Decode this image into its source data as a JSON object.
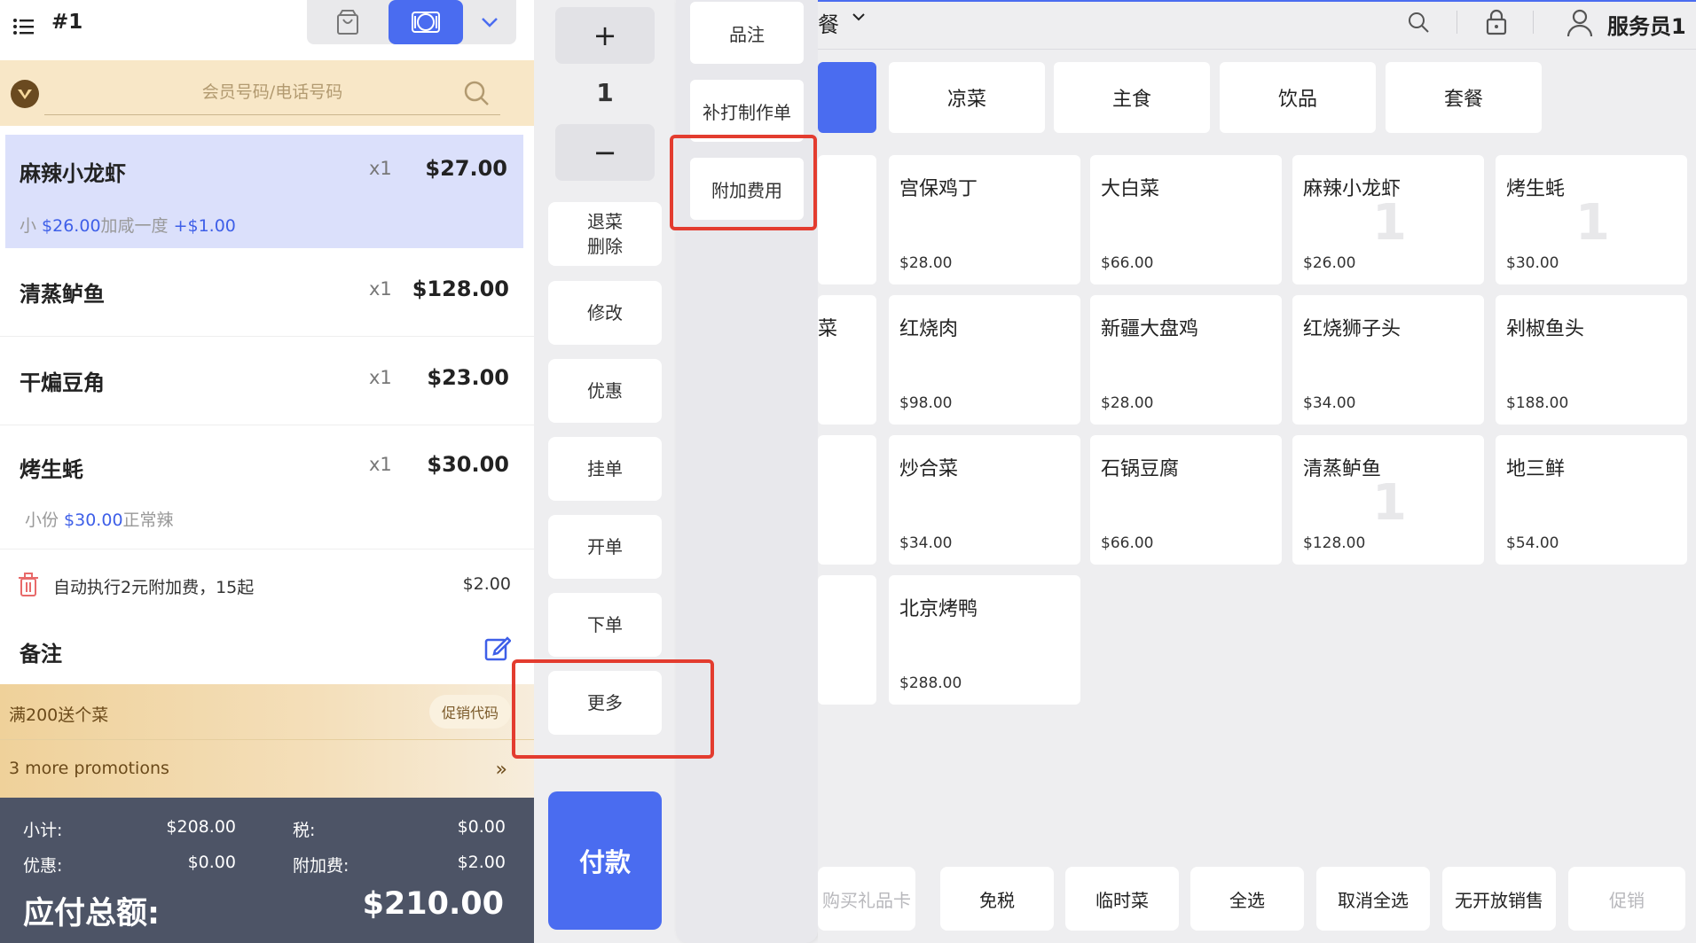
{
  "header": {
    "order_number": "#1"
  },
  "member": {
    "placeholder": "会员号码/电话号码"
  },
  "order_items": [
    {
      "name": "麻辣小龙虾",
      "qty": "x1",
      "price": "$27.00",
      "mod_prefix": "小 ",
      "mod_price": "$26.00",
      "mod_text": "加咸一度 ",
      "mod_extra": "+$1.00"
    },
    {
      "name": "清蒸鲈鱼",
      "qty": "x1",
      "price": "$128.00"
    },
    {
      "name": "干煸豆角",
      "qty": "x1",
      "price": "$23.00"
    },
    {
      "name": "烤生蚝",
      "qty": "x1",
      "price": "$30.00",
      "mod_prefix": "小份 ",
      "mod_price": "$30.00",
      "mod_text": "正常辣"
    }
  ],
  "surcharge": {
    "label": "自动执行2元附加费，15起",
    "amount": "$2.00"
  },
  "note": {
    "label": "备注"
  },
  "promotions": {
    "line1": "满200送个菜",
    "code_button": "促销代码",
    "more": "3 more promotions",
    "arrow": "»"
  },
  "summary": {
    "subtotal_label": "小计:",
    "subtotal": "$208.00",
    "tax_label": "税:",
    "tax": "$0.00",
    "discount_label": "优惠:",
    "discount": "$0.00",
    "fee_label": "附加费:",
    "fee": "$2.00",
    "total_label": "应付总额:",
    "total": "$210.00"
  },
  "actions": {
    "plus": "+",
    "qty": "1",
    "minus": "−",
    "void_line1": "退菜",
    "void_line2": "删除",
    "modify": "修改",
    "discount": "优惠",
    "hold": "挂单",
    "open": "开单",
    "place": "下单",
    "more": "更多",
    "pay": "付款"
  },
  "more_menu": {
    "note": "品注",
    "reprint": "补打制作单",
    "extra_fee": "附加费用"
  },
  "top_right": {
    "category_partial": "餐",
    "user": "服务员1"
  },
  "categories": [
    "凉菜",
    "主食",
    "饮品",
    "套餐"
  ],
  "dishes": [
    {
      "name": "宫保鸡丁",
      "price": "$28.00",
      "qty": ""
    },
    {
      "name": "大白菜",
      "price": "$66.00",
      "qty": ""
    },
    {
      "name": "麻辣小龙虾",
      "price": "$26.00",
      "qty": "1"
    },
    {
      "name": "烤生蚝",
      "price": "$30.00",
      "qty": "1"
    },
    {
      "name": "红烧肉",
      "price": "$98.00",
      "qty": ""
    },
    {
      "name": "新疆大盘鸡",
      "price": "$28.00",
      "qty": ""
    },
    {
      "name": "红烧狮子头",
      "price": "$34.00",
      "qty": ""
    },
    {
      "name": "剁椒鱼头",
      "price": "$188.00",
      "qty": ""
    },
    {
      "name": "炒合菜",
      "price": "$34.00",
      "qty": ""
    },
    {
      "name": "石锅豆腐",
      "price": "$66.00",
      "qty": ""
    },
    {
      "name": "清蒸鲈鱼",
      "price": "$128.00",
      "qty": "1"
    },
    {
      "name": "地三鲜",
      "price": "$54.00",
      "qty": ""
    },
    {
      "name": "北京烤鸭",
      "price": "$288.00",
      "qty": ""
    }
  ],
  "partial_dish_label": "菜",
  "bottom_actions": [
    {
      "label": "购买礼品卡",
      "disabled": true
    },
    {
      "label": "免税",
      "disabled": false
    },
    {
      "label": "临时菜",
      "disabled": false
    },
    {
      "label": "全选",
      "disabled": false
    },
    {
      "label": "取消全选",
      "disabled": false
    },
    {
      "label": "无开放销售",
      "disabled": false
    },
    {
      "label": "促销",
      "disabled": true
    }
  ],
  "colors": {
    "accent": "#4a6cf0",
    "highlight": "#e33c2f",
    "summary_bg": "#4d5466",
    "member_bg": "#f8e7c7"
  },
  "icons": [
    "list-icon",
    "bag-icon",
    "dine-in-icon",
    "chevron-down-icon",
    "vip-icon",
    "search-icon",
    "trash-icon",
    "edit-icon",
    "lock-icon",
    "user-icon"
  ]
}
